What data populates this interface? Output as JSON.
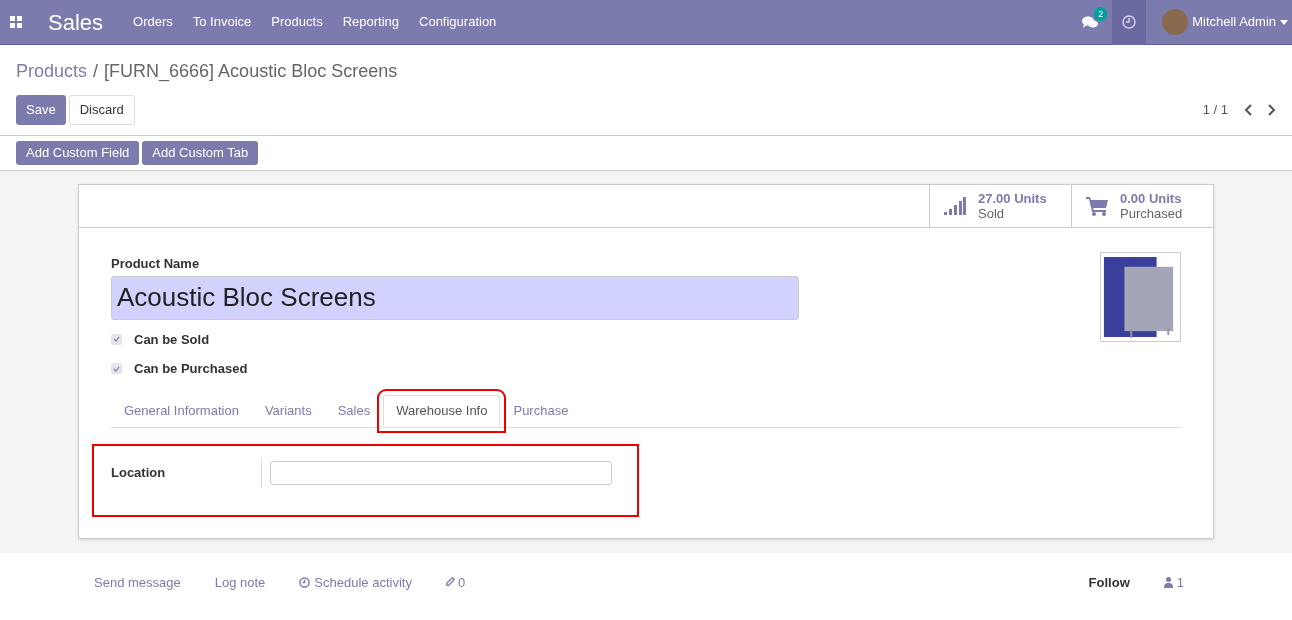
{
  "navbar": {
    "app_name": "Sales",
    "menu": [
      {
        "label": "Orders"
      },
      {
        "label": "To Invoice"
      },
      {
        "label": "Products"
      },
      {
        "label": "Reporting"
      },
      {
        "label": "Configuration"
      }
    ],
    "messages_badge": "2",
    "user_name": "Mitchell Admin"
  },
  "breadcrumb": {
    "parent": "Products",
    "separator": "/",
    "current": "[FURN_6666] Acoustic Bloc Screens"
  },
  "actions": {
    "save": "Save",
    "discard": "Discard",
    "pager": "1 / 1"
  },
  "studio_buttons": [
    "Add Custom Field",
    "Add Custom Tab"
  ],
  "smart_buttons": [
    {
      "kind": "chart",
      "value": "27.00 Units",
      "label": "Sold"
    },
    {
      "kind": "cart",
      "value": "0.00 Units",
      "label": "Purchased"
    }
  ],
  "form": {
    "name_label": "Product Name",
    "name_value": "Acoustic Bloc Screens",
    "checkboxes": [
      {
        "label": "Can be Sold",
        "checked": true
      },
      {
        "label": "Can be Purchased",
        "checked": true
      }
    ],
    "tabs": [
      {
        "label": "General Information",
        "selected": false
      },
      {
        "label": "Variants",
        "selected": false
      },
      {
        "label": "Sales",
        "selected": false
      },
      {
        "label": "Warehouse Info",
        "selected": true
      },
      {
        "label": "Purchase",
        "selected": false
      }
    ],
    "location_label": "Location"
  },
  "chatter": {
    "send_message": "Send message",
    "log_note": "Log note",
    "schedule_activity": "Schedule activity",
    "attachments": "0",
    "follow": "Follow",
    "followers": "1"
  }
}
